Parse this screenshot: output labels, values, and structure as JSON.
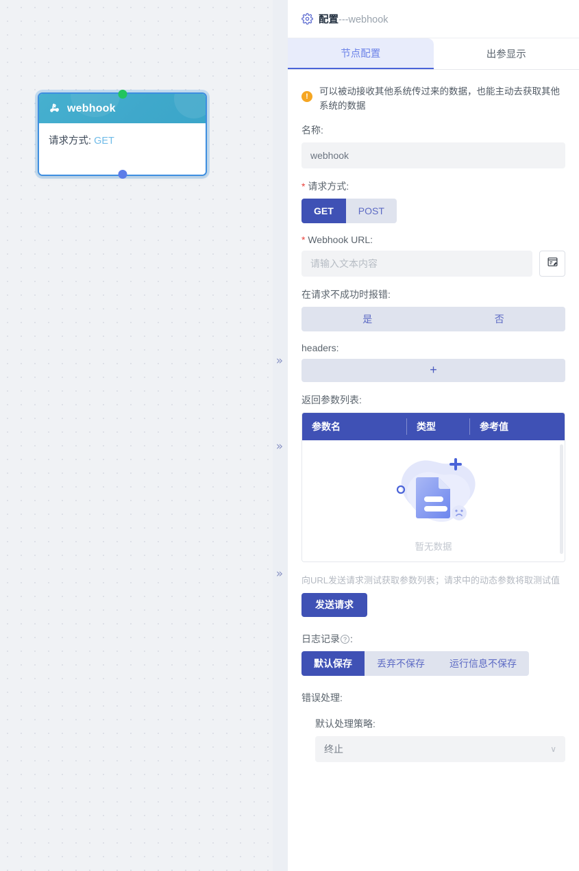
{
  "canvas": {
    "collapse_handles": [
      "»",
      "»",
      "»"
    ],
    "node": {
      "icon": "webhook-icon",
      "title": "webhook",
      "body_label": "请求方式:",
      "body_value": "GET",
      "input_port": "input-port",
      "output_port": "output-port"
    }
  },
  "panel": {
    "header": {
      "icon": "gear-icon",
      "title_main": "配置",
      "title_sub": "---webhook"
    },
    "tabs": [
      {
        "label": "节点配置",
        "active": true
      },
      {
        "label": "出参显示",
        "active": false
      }
    ],
    "notice": {
      "icon": "warning-icon",
      "text": "可以被动接收其他系统传过来的数据，也能主动去获取其他系统的数据"
    },
    "name_field": {
      "label": "名称:",
      "value": "webhook"
    },
    "method_field": {
      "label": "请求方式:",
      "required": true,
      "options": [
        "GET",
        "POST"
      ],
      "selected": "GET"
    },
    "url_field": {
      "label": "Webhook URL:",
      "required": true,
      "placeholder": "请输入文本内容",
      "value": "",
      "edit_icon": "form-edit-icon"
    },
    "fail_field": {
      "label": "在请求不成功时报错:",
      "options": [
        "是",
        "否"
      ],
      "selected": ""
    },
    "headers_field": {
      "label": "headers:",
      "add_label": "+"
    },
    "params_table": {
      "label": "返回参数列表:",
      "columns": [
        "参数名",
        "类型",
        "参考值"
      ],
      "rows": [],
      "empty_text": "暂无数据"
    },
    "send_request": {
      "hint": "向URL发送请求测试获取参数列表；请求中的动态参数将取测试值",
      "button_label": "发送请求"
    },
    "log_field": {
      "label": "日志记录",
      "help_icon": "question-icon",
      "label_suffix": ":",
      "options": [
        "默认保存",
        "丢弃不保存",
        "运行信息不保存"
      ],
      "selected": "默认保存"
    },
    "error_section": {
      "label": "错误处理:",
      "strategy_label": "默认处理策略:",
      "strategy_value": "终止",
      "chevron": "∨"
    }
  },
  "colors": {
    "accent": "#3f51b5",
    "node_header": "#3fa8cb",
    "node_border": "#3d8ee0",
    "port_in": "#22c55e",
    "port_out": "#5b7ce8",
    "warning": "#f5a623",
    "canvas_bg": "#f0f2f5"
  }
}
